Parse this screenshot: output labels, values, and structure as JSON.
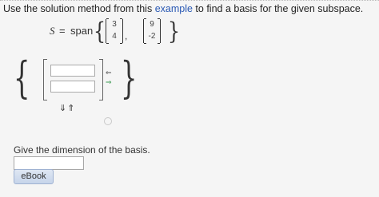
{
  "instruction": {
    "prefix": "Use the solution method from this",
    "link": "example",
    "suffix": "to find a basis for the given subspace."
  },
  "equation": {
    "lhs": "S",
    "operator": "=",
    "function": "span",
    "vectors": [
      {
        "entries": [
          "3",
          "4"
        ]
      },
      {
        "entries": [
          "9",
          "-2"
        ]
      }
    ],
    "separator": ","
  },
  "widget": {
    "add_column_symbol": "⇐",
    "remove_column_symbol": "⇒",
    "row_controls": "⇓⇑"
  },
  "question": {
    "text": "Give the dimension of the basis.",
    "answer_value": ""
  },
  "ebook_button": {
    "label": "eBook"
  },
  "colors": {
    "link": "#2a59b4",
    "button_bg": "#c6d4ea",
    "remove_arrow": "#3c9a52"
  }
}
